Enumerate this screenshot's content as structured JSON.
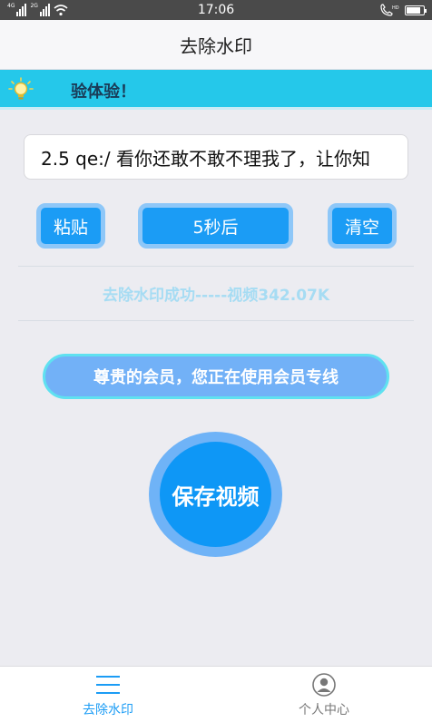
{
  "status_bar": {
    "time": "17:06",
    "network_tag_1": "4G",
    "network_tag_2": "2G"
  },
  "header": {
    "title": "去除水印"
  },
  "notice": {
    "text": "验体验！"
  },
  "input": {
    "value": "2.5 qe:/ 看你还敢不敢不理我了，让你知"
  },
  "buttons": {
    "paste": "粘贴",
    "countdown": "5秒后",
    "clear": "清空"
  },
  "result": {
    "text": "去除水印成功-----视频342.07K"
  },
  "member": {
    "text": "尊贵的会员，您正在使用会员专线"
  },
  "save": {
    "label": "保存视频"
  },
  "bottom_nav": {
    "items": [
      {
        "label": "去除水印",
        "icon": "menu-icon",
        "active": true
      },
      {
        "label": "个人中心",
        "icon": "user-icon",
        "active": false
      }
    ]
  },
  "colors": {
    "accent": "#1b9cf5",
    "banner": "#25c8ea",
    "member_pill": "#72b1f7",
    "result_text": "#a6dcf3"
  }
}
